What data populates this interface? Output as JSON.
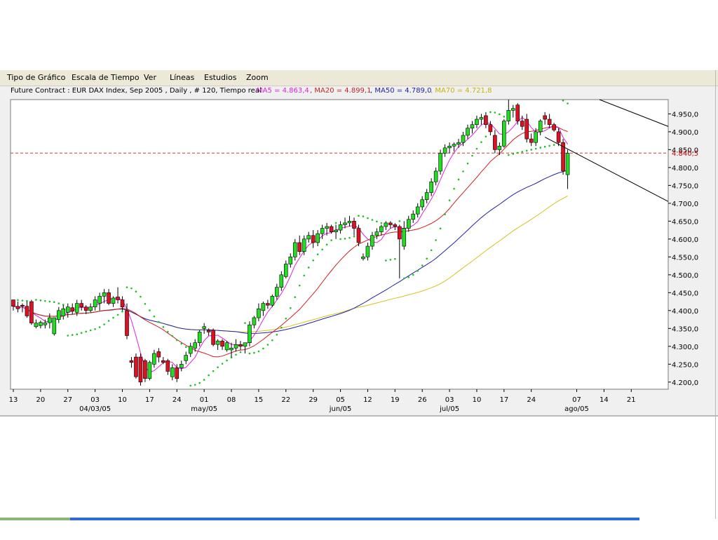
{
  "menu": {
    "items": [
      "Tipo de Gráfico",
      "Escala de Tiempo",
      "Ver",
      "Líneas",
      "Estudios",
      "Zoom"
    ]
  },
  "header": {
    "contract": "Future Contract : EUR DAX Index, Sep 2005 , Daily , # 120, Tiempo real",
    "ma5": "MA5 = 4.863,4",
    "ma20": ", MA20 = 4.899,1",
    "ma50": ", MA50 = 4.789,0",
    "ma70": ", MA70 = 4.721,8"
  },
  "colors": {
    "up": "#22dd22",
    "down": "#dd1122",
    "ma5": "#dd22dd",
    "ma20": "#cc2222",
    "ma50": "#2222aa",
    "ma70": "#d4c21a",
    "sar": "#1fbf1f",
    "ref": "#dd3333"
  },
  "chart_data": {
    "type": "candlestick",
    "y_axis": {
      "min": 4180,
      "max": 4990,
      "ticks": [
        "4.950,0",
        "4.900,0",
        "4.850,0",
        "4.800,0",
        "4.750,0",
        "4.700,0",
        "4.650,0",
        "4.600,0",
        "4.550,0",
        "4.500,0",
        "4.450,0",
        "4.400,0",
        "4.350,0",
        "4.300,0",
        "4.250,0",
        "4.200,0"
      ],
      "tick_values": [
        4950,
        4900,
        4850,
        4800,
        4750,
        4700,
        4650,
        4600,
        4550,
        4500,
        4450,
        4400,
        4350,
        4300,
        4250,
        4200
      ]
    },
    "reference_line": {
      "value": 4840.5,
      "label": "4.840,5"
    },
    "x_axis": {
      "day_labels": [
        "13",
        "20",
        "27",
        "03",
        "10",
        "17",
        "24",
        "01",
        "08",
        "15",
        "22",
        "29",
        "05",
        "12",
        "19",
        "26",
        "03",
        "10",
        "17",
        "24",
        "07",
        "14",
        "21"
      ],
      "day_label_index": [
        0,
        6,
        12,
        18,
        24,
        30,
        36,
        42,
        48,
        54,
        60,
        66,
        72,
        78,
        84,
        90,
        96,
        102,
        108,
        114,
        124,
        130,
        136
      ],
      "month_labels": [
        "04/03/05",
        "may/05",
        "jun/05",
        "jul/05",
        "ago/05"
      ],
      "month_label_index": [
        18,
        42,
        72,
        96,
        124
      ]
    },
    "ohlc_series": [
      [
        4430,
        4430,
        4400,
        4412
      ],
      [
        4412,
        4425,
        4395,
        4405
      ],
      [
        4415,
        4420,
        4395,
        4412
      ],
      [
        4412,
        4425,
        4380,
        4385
      ],
      [
        4425,
        4430,
        4360,
        4365
      ],
      [
        4355,
        4375,
        4350,
        4365
      ],
      [
        4358,
        4372,
        4350,
        4367
      ],
      [
        4360,
        4375,
        4350,
        4366
      ],
      [
        4366,
        4392,
        4350,
        4380
      ],
      [
        4335,
        4380,
        4330,
        4380
      ],
      [
        4375,
        4410,
        4365,
        4400
      ],
      [
        4385,
        4415,
        4375,
        4405
      ],
      [
        4395,
        4420,
        4380,
        4410
      ],
      [
        4408,
        4420,
        4390,
        4398
      ],
      [
        4395,
        4430,
        4385,
        4420
      ],
      [
        4420,
        4430,
        4400,
        4410
      ],
      [
        4410,
        4415,
        4390,
        4400
      ],
      [
        4400,
        4420,
        4395,
        4410
      ],
      [
        4410,
        4440,
        4400,
        4430
      ],
      [
        4420,
        4450,
        4400,
        4440
      ],
      [
        4440,
        4460,
        4420,
        4450
      ],
      [
        4450,
        4460,
        4415,
        4420
      ],
      [
        4420,
        4440,
        4410,
        4435
      ],
      [
        4438,
        4465,
        4420,
        4430
      ],
      [
        4430,
        4440,
        4400,
        4410
      ],
      [
        4400,
        4420,
        4320,
        4330
      ],
      [
        4260,
        4270,
        4240,
        4255
      ],
      [
        4270,
        4280,
        4210,
        4215
      ],
      [
        4270,
        4280,
        4190,
        4200
      ],
      [
        4260,
        4265,
        4200,
        4210
      ],
      [
        4210,
        4260,
        4205,
        4255
      ],
      [
        4250,
        4290,
        4240,
        4280
      ],
      [
        4285,
        4295,
        4255,
        4270
      ],
      [
        4260,
        4270,
        4250,
        4255
      ],
      [
        4260,
        4265,
        4220,
        4230
      ],
      [
        4215,
        4250,
        4205,
        4240
      ],
      [
        4240,
        4250,
        4200,
        4210
      ],
      [
        4240,
        4260,
        4230,
        4250
      ],
      [
        4260,
        4285,
        4250,
        4275
      ],
      [
        4280,
        4310,
        4270,
        4300
      ],
      [
        4295,
        4320,
        4285,
        4310
      ],
      [
        4310,
        4345,
        4300,
        4340
      ],
      [
        4350,
        4365,
        4335,
        4355
      ],
      [
        4345,
        4350,
        4330,
        4340
      ],
      [
        4345,
        4350,
        4300,
        4305
      ],
      [
        4305,
        4320,
        4290,
        4315
      ],
      [
        4315,
        4320,
        4290,
        4300
      ],
      [
        4290,
        4315,
        4285,
        4310
      ],
      [
        4290,
        4310,
        4270,
        4295
      ],
      [
        4295,
        4320,
        4285,
        4305
      ],
      [
        4305,
        4315,
        4290,
        4300
      ],
      [
        4300,
        4310,
        4280,
        4310
      ],
      [
        4310,
        4370,
        4300,
        4360
      ],
      [
        4360,
        4385,
        4350,
        4380
      ],
      [
        4380,
        4420,
        4370,
        4405
      ],
      [
        4400,
        4425,
        4385,
        4420
      ],
      [
        4420,
        4430,
        4405,
        4415
      ],
      [
        4415,
        4445,
        4410,
        4440
      ],
      [
        4440,
        4475,
        4430,
        4465
      ],
      [
        4465,
        4510,
        4455,
        4500
      ],
      [
        4495,
        4540,
        4490,
        4530
      ],
      [
        4530,
        4560,
        4520,
        4550
      ],
      [
        4550,
        4600,
        4540,
        4590
      ],
      [
        4590,
        4610,
        4555,
        4565
      ],
      [
        4565,
        4610,
        4555,
        4600
      ],
      [
        4600,
        4620,
        4590,
        4610
      ],
      [
        4610,
        4625,
        4575,
        4590
      ],
      [
        4590,
        4625,
        4580,
        4615
      ],
      [
        4615,
        4640,
        4600,
        4630
      ],
      [
        4630,
        4645,
        4610,
        4635
      ],
      [
        4635,
        4640,
        4615,
        4620
      ],
      [
        4620,
        4640,
        4600,
        4625
      ],
      [
        4625,
        4650,
        4615,
        4640
      ],
      [
        4640,
        4660,
        4630,
        4645
      ],
      [
        4645,
        4665,
        4635,
        4650
      ],
      [
        4650,
        4660,
        4610,
        4630
      ],
      [
        4630,
        4640,
        4580,
        4590
      ],
      [
        4545,
        4560,
        4540,
        4550
      ],
      [
        4550,
        4590,
        4540,
        4580
      ],
      [
        4580,
        4620,
        4570,
        4610
      ],
      [
        4610,
        4630,
        4600,
        4620
      ],
      [
        4620,
        4640,
        4610,
        4635
      ],
      [
        4635,
        4650,
        4625,
        4645
      ],
      [
        4645,
        4650,
        4630,
        4640
      ],
      [
        4640,
        4645,
        4625,
        4635
      ],
      [
        4635,
        4640,
        4490,
        4600
      ],
      [
        4580,
        4650,
        4570,
        4630
      ],
      [
        4630,
        4665,
        4620,
        4655
      ],
      [
        4655,
        4680,
        4645,
        4670
      ],
      [
        4670,
        4700,
        4660,
        4690
      ],
      [
        4690,
        4720,
        4680,
        4710
      ],
      [
        4710,
        4740,
        4700,
        4730
      ],
      [
        4730,
        4770,
        4720,
        4760
      ],
      [
        4760,
        4800,
        4750,
        4790
      ],
      [
        4790,
        4850,
        4780,
        4840
      ],
      [
        4840,
        4865,
        4830,
        4855
      ],
      [
        4855,
        4870,
        4840,
        4860
      ],
      [
        4860,
        4870,
        4845,
        4865
      ],
      [
        4865,
        4880,
        4855,
        4870
      ],
      [
        4870,
        4900,
        4860,
        4890
      ],
      [
        4890,
        4920,
        4880,
        4910
      ],
      [
        4910,
        4930,
        4895,
        4920
      ],
      [
        4920,
        4945,
        4910,
        4935
      ],
      [
        4935,
        4950,
        4920,
        4940
      ],
      [
        4945,
        4955,
        4910,
        4920
      ],
      [
        4920,
        4930,
        4890,
        4900
      ],
      [
        4890,
        4905,
        4840,
        4850
      ],
      [
        4850,
        4870,
        4835,
        4860
      ],
      [
        4860,
        4935,
        4855,
        4930
      ],
      [
        4930,
        4990,
        4920,
        4960
      ],
      [
        4960,
        4975,
        4940,
        4965
      ],
      [
        4975,
        4980,
        4920,
        4930
      ],
      [
        4930,
        4945,
        4905,
        4915
      ],
      [
        4935,
        4950,
        4870,
        4880
      ],
      [
        4880,
        4895,
        4860,
        4870
      ],
      [
        4870,
        4910,
        4860,
        4900
      ],
      [
        4900,
        4935,
        4890,
        4930
      ],
      [
        4945,
        4955,
        4920,
        4935
      ],
      [
        4935,
        4950,
        4910,
        4920
      ],
      [
        4920,
        4925,
        4900,
        4905
      ],
      [
        4900,
        4910,
        4860,
        4870
      ],
      [
        4870,
        4880,
        4780,
        4790
      ],
      [
        4780,
        4850,
        4740,
        4840
      ]
    ],
    "legend": [
      "MA5",
      "MA20",
      "MA50",
      "MA70"
    ]
  }
}
